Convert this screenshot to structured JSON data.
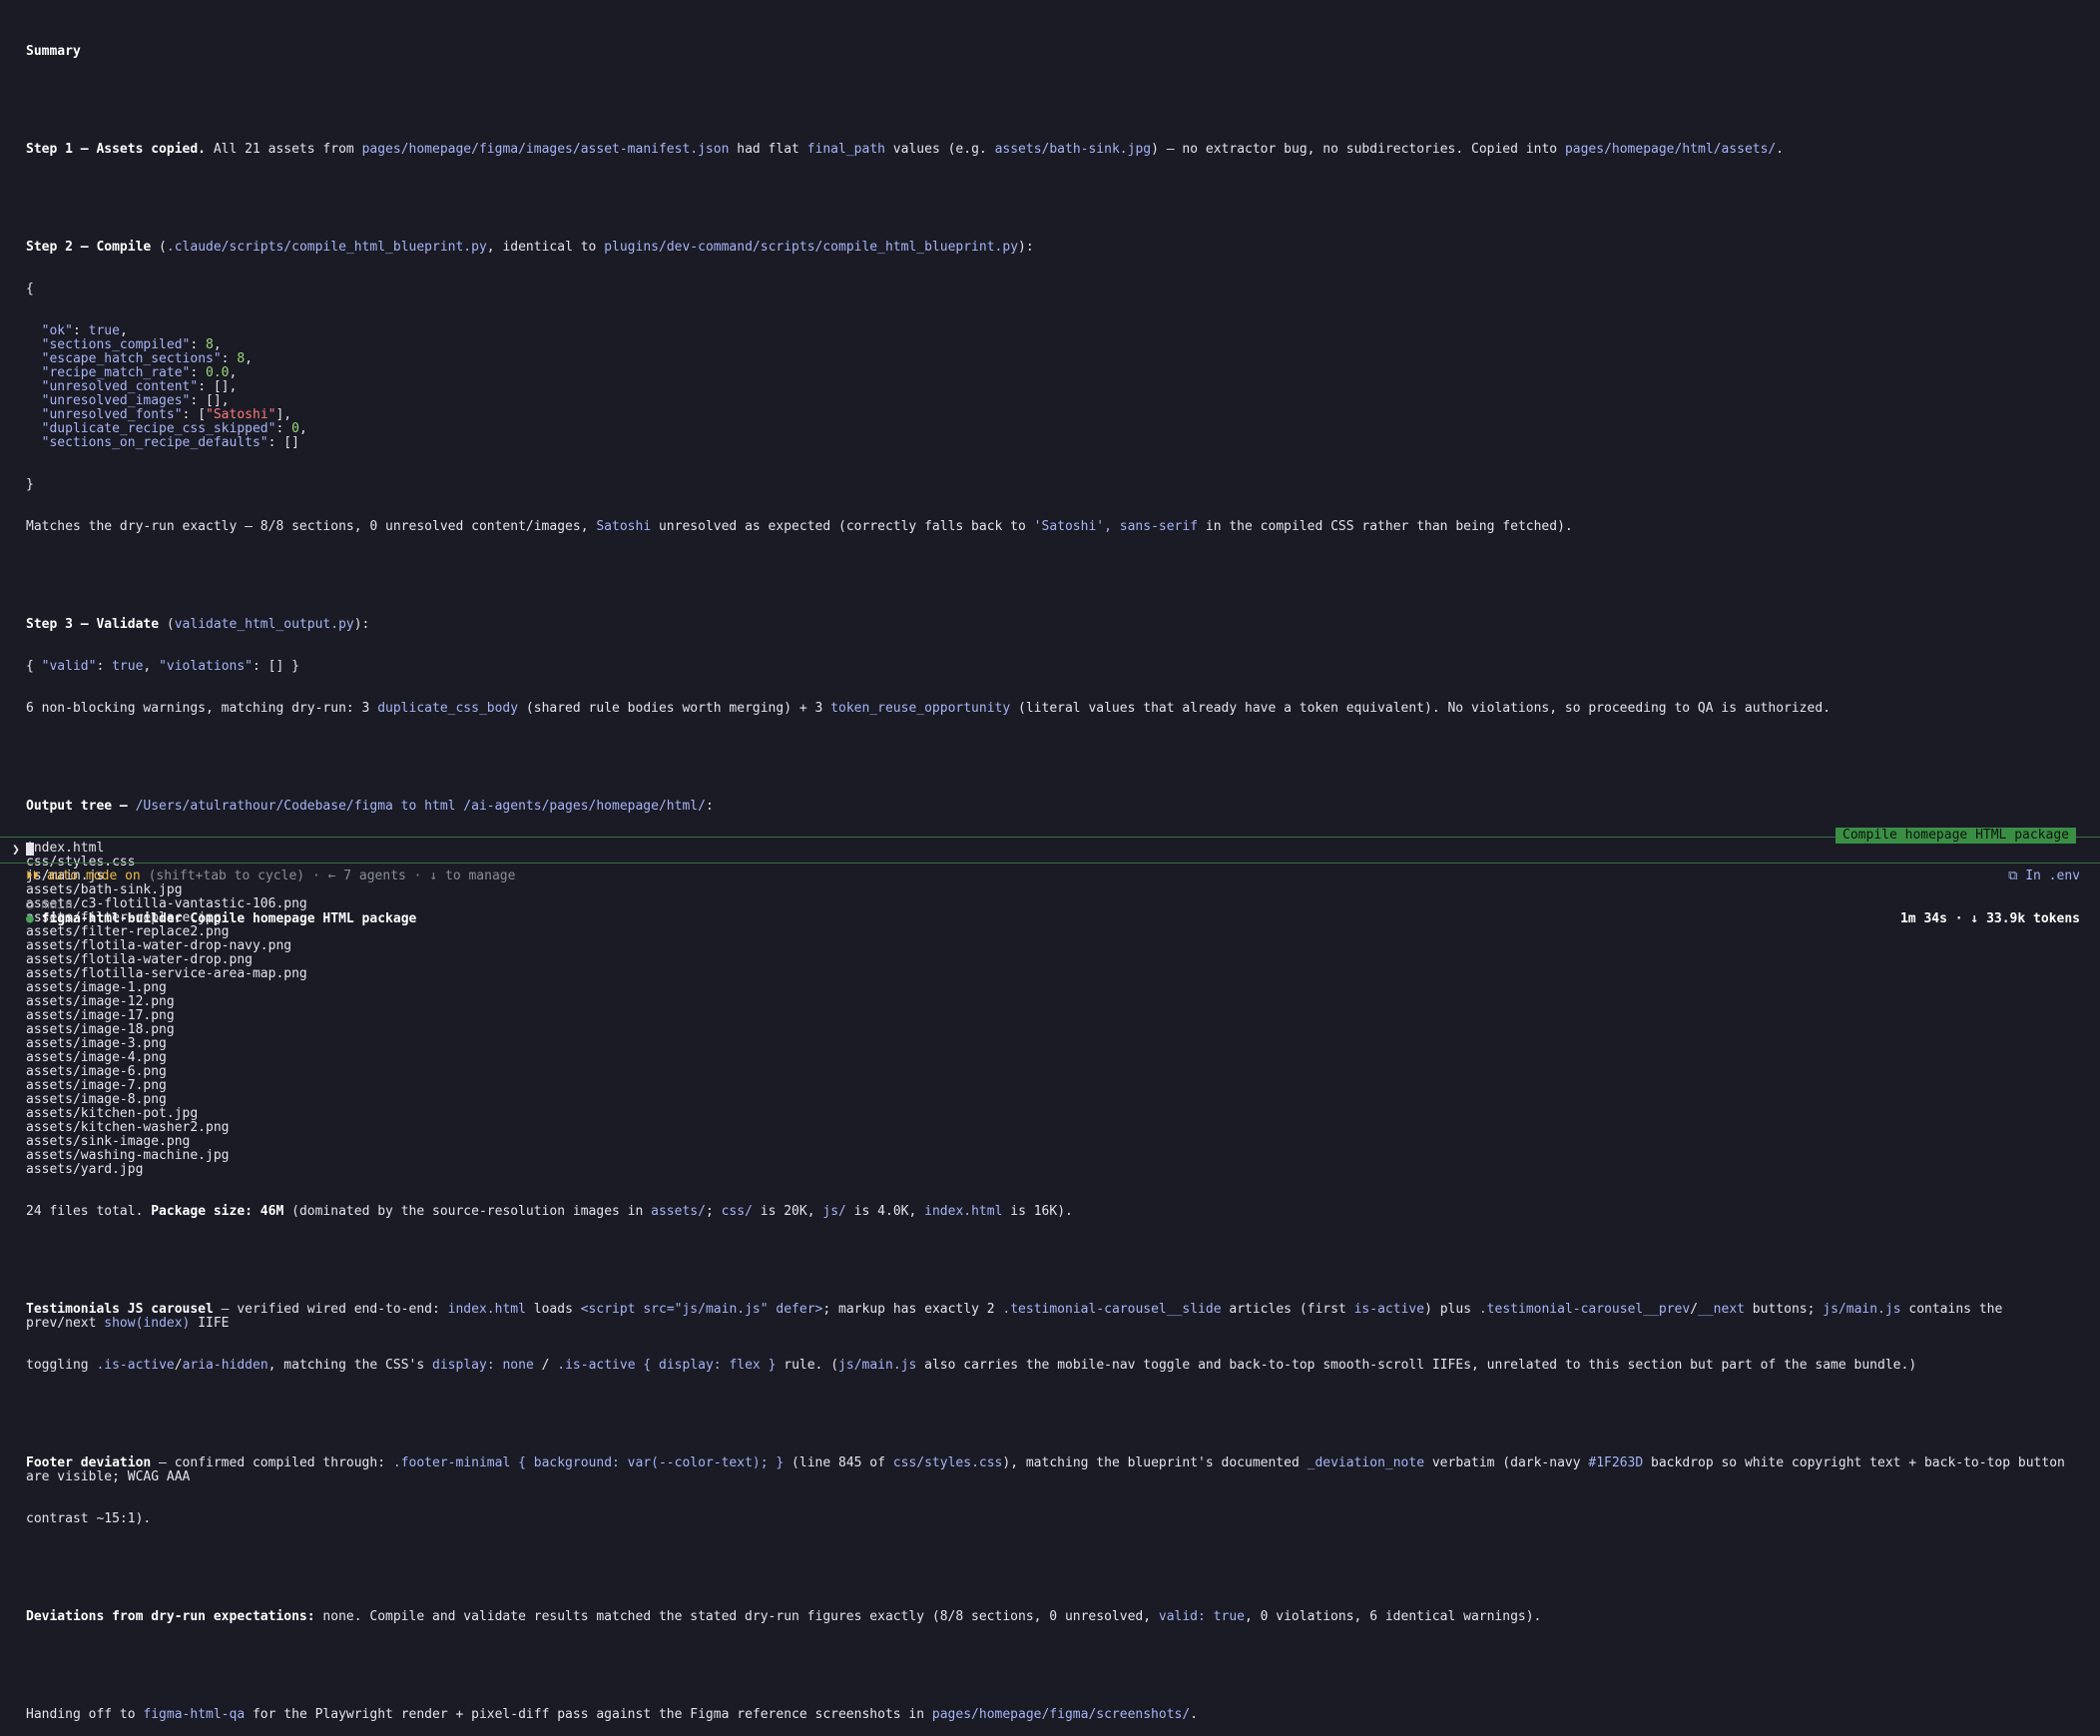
{
  "summary_title": "Summary",
  "step1": {
    "label": "Step 1 — Assets copied.",
    "t1": " All 21 assets from ",
    "p1": "pages/homepage/figma/images/asset-manifest.json",
    "t2": " had flat ",
    "p2": "final_path",
    "t3": " values (e.g. ",
    "p3": "assets/bath-sink.jpg",
    "t4": ") — no extractor bug, no subdirectories. Copied into ",
    "p4": "pages/homepage/html/assets/",
    "t5": "."
  },
  "step2": {
    "label": "Step 2 — Compile",
    "t1": " (",
    "p1": ".claude/scripts/compile_html_blueprint.py",
    "t2": ", identical to ",
    "p2": "plugins/dev-command/scripts/compile_html_blueprint.py",
    "t3": "):",
    "open": "{",
    "close": "}",
    "json_lines": [
      {
        "key": "\"ok\"",
        "sep": ": ",
        "val": "true",
        "vclass": "path",
        "tail": ","
      },
      {
        "key": "\"sections_compiled\"",
        "sep": ": ",
        "val": "8",
        "vclass": "num",
        "tail": ","
      },
      {
        "key": "\"escape_hatch_sections\"",
        "sep": ": ",
        "val": "8",
        "vclass": "num",
        "tail": ","
      },
      {
        "key": "\"recipe_match_rate\"",
        "sep": ": ",
        "val": "0.0",
        "vclass": "num",
        "tail": ","
      },
      {
        "key": "\"unresolved_content\"",
        "sep": ": ",
        "val": "[]",
        "vclass": "plain",
        "tail": ","
      },
      {
        "key": "\"unresolved_images\"",
        "sep": ": ",
        "val": "[]",
        "vclass": "plain",
        "tail": ","
      },
      {
        "key": "\"unresolved_fonts\"",
        "sep": ": [",
        "val": "\"Satoshi\"",
        "vclass": "str",
        "tail": "],"
      },
      {
        "key": "\"duplicate_recipe_css_skipped\"",
        "sep": ": ",
        "val": "0",
        "vclass": "num",
        "tail": ","
      },
      {
        "key": "\"sections_on_recipe_defaults\"",
        "sep": ": ",
        "val": "[]",
        "vclass": "plain",
        "tail": ""
      }
    ],
    "after1": "Matches the dry-run exactly — 8/8 sections, 0 unresolved content/images, ",
    "after_p1": "Satoshi",
    "after2": " unresolved as expected (correctly falls back to ",
    "after_p2": "'Satoshi', sans-serif",
    "after3": " in the compiled CSS rather than being fetched)."
  },
  "step3": {
    "label": "Step 3 — Validate",
    "t1": " (",
    "p1": "validate_html_output.py",
    "t2": "):",
    "j1": "{ ",
    "jk1": "\"valid\"",
    "j2": ": ",
    "jv1": "true",
    "j3": ", ",
    "jk2": "\"violations\"",
    "j4": ": [] }",
    "w1": "6 non-blocking warnings, matching dry-run: 3 ",
    "wp1": "duplicate_css_body",
    "w2": " (shared rule bodies worth merging) + 3 ",
    "wp2": "token_reuse_opportunity",
    "w3": " (literal values that already have a token equivalent). No violations, so proceeding to QA is authorized."
  },
  "output_tree": {
    "label": "Output tree —",
    "t1": " ",
    "path": "/Users/atulrathour/Codebase/figma to html /ai-agents/pages/homepage/html/",
    "t2": ":",
    "files": [
      "index.html",
      "css/styles.css",
      "js/main.js",
      "assets/bath-sink.jpg",
      "assets/c3-flotilla-vantastic-106.png",
      "assets/filter-replace.jpg",
      "assets/filter-replace2.png",
      "assets/flotila-water-drop-navy.png",
      "assets/flotila-water-drop.png",
      "assets/flotilla-service-area-map.png",
      "assets/image-1.png",
      "assets/image-12.png",
      "assets/image-17.png",
      "assets/image-18.png",
      "assets/image-3.png",
      "assets/image-4.png",
      "assets/image-6.png",
      "assets/image-7.png",
      "assets/image-8.png",
      "assets/kitchen-pot.jpg",
      "assets/kitchen-washer2.png",
      "assets/sink-image.png",
      "assets/washing-machine.jpg",
      "assets/yard.jpg"
    ],
    "total1": "24 files total. ",
    "total_b": "Package size: 46M",
    "total2": " (dominated by the source-resolution images in ",
    "tp1": "assets/",
    "total3": "; ",
    "tp2": "css/",
    "total4": " is 20K, ",
    "tp3": "js/",
    "total5": " is 4.0K, ",
    "tp4": "index.html",
    "total6": " is 16K)."
  },
  "testimonials": {
    "label": "Testimonials JS carousel",
    "t1": " — verified wired end-to-end: ",
    "p1": "index.html",
    "t2": " loads ",
    "p2": "<script src=\"js/main.js\" defer>",
    "t3": "; markup has exactly 2 ",
    "p3": ".testimonial-carousel__slide",
    "t4": " articles (first ",
    "p4": "is-active",
    "t5": ") plus ",
    "p5": ".testimonial-carousel__prev",
    "t6": "/",
    "p6": "__next",
    "t7": " buttons; ",
    "p7": "js/main.js",
    "t8": " contains the prev/next ",
    "p8": "show(index)",
    "t9": " IIFE",
    "l2a": "toggling ",
    "l2p1": ".is-active",
    "l2b": "/",
    "l2p2": "aria-hidden",
    "l2c": ", matching the CSS's ",
    "l2p3": "display: none",
    "l2d": " / ",
    "l2p4": ".is-active { display: flex }",
    "l2e": " rule. (",
    "l2p5": "js/main.js",
    "l2f": " also carries the mobile-nav toggle and back-to-top smooth-scroll IIFEs, unrelated to this section but part of the same bundle.)"
  },
  "footer": {
    "label": "Footer deviation",
    "t1": " — confirmed compiled through: ",
    "p1": ".footer-minimal { background: var(--color-text); }",
    "t2": " (line 845 of ",
    "p2": "css/styles.css",
    "t3": "), matching the blueprint's documented ",
    "p3": "_deviation_note",
    "t4": " verbatim (dark-navy ",
    "p4": "#1F263D",
    "t5": " backdrop so white copyright text + back-to-top button are visible; WCAG AAA",
    "l2": "contrast ~15:1)."
  },
  "deviations": {
    "label": "Deviations from dry-run expectations:",
    "t1": " none. Compile and validate results matched the stated dry-run figures exactly (8/8 sections, 0 unresolved, ",
    "p1": "valid: true",
    "t2": ", 0 violations, 6 identical warnings)."
  },
  "handoff": {
    "t1": "Handing off to ",
    "p1": "figma-html-qa",
    "t2": " for the Playwright render + pixel-diff pass against the Figma reference screenshots in ",
    "p2": "pages/homepage/figma/screenshots/",
    "t3": "."
  },
  "task_badge": "Compile homepage HTML package",
  "prompt_symbol": "❯",
  "status": {
    "mode": "⏵⏵ auto mode on",
    "hint": " (shift+tab to cycle) · ← 7 agents · ↓ to manage"
  },
  "env": "⧉ In .env",
  "branch": "○ main",
  "agent": {
    "bullet": "●",
    "name": " figma-html-builder",
    "task": "  Compile homepage HTML package",
    "stats": "1m 34s · ↓ 33.9k tokens"
  },
  "colors": {
    "background": "#1a1b25",
    "path": "#a7b4f5",
    "number": "#9ad879",
    "string": "#ff7a7a",
    "accent_green": "#3a8f45",
    "auto_mode": "#f1b94a"
  }
}
